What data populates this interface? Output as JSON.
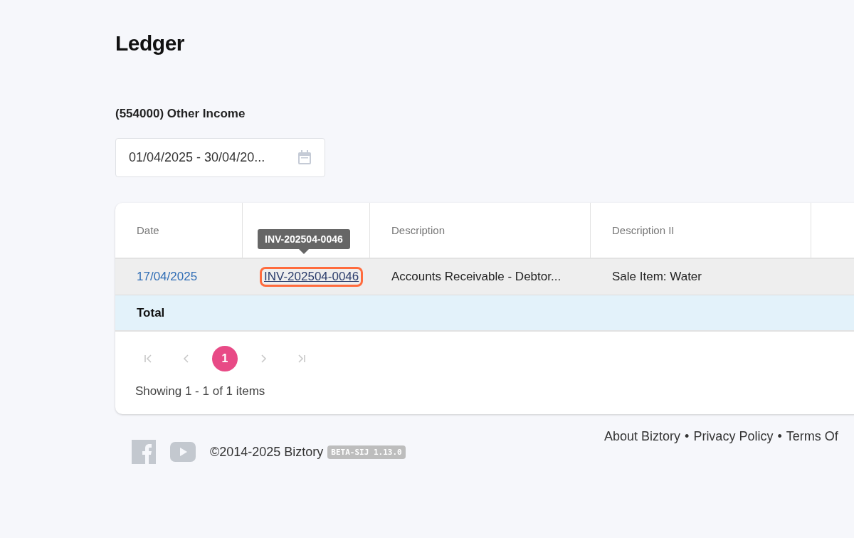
{
  "page": {
    "title": "Ledger",
    "account": "(554000) Other Income"
  },
  "date_range": {
    "value": "01/04/2025 - 30/04/20..."
  },
  "table": {
    "columns": [
      {
        "label": "Date"
      },
      {},
      {
        "label": "Description"
      },
      {
        "label": "Description II"
      },
      {}
    ],
    "tooltip": "INV-202504-0046",
    "rows": [
      {
        "date": "17/04/2025",
        "ref": "INV-202504-0046",
        "ref_highlighted": true,
        "description": "Accounts Receivable - Debtor...",
        "description_2": "Sale Item: Water",
        "hovered": true
      }
    ],
    "total": {
      "label": "Total"
    }
  },
  "pager": {
    "nav_disabled": true,
    "pages": [
      {
        "label": "1",
        "selected": true
      }
    ],
    "summary": "Showing 1 - 1 of 1 items"
  },
  "footer": {
    "copyright": "©2014-2025 Biztory",
    "version": "BETA-SIJ 1.13.0",
    "separator": "•",
    "links": [
      "About Biztory",
      "Privacy Policy",
      "Terms Of"
    ]
  }
}
